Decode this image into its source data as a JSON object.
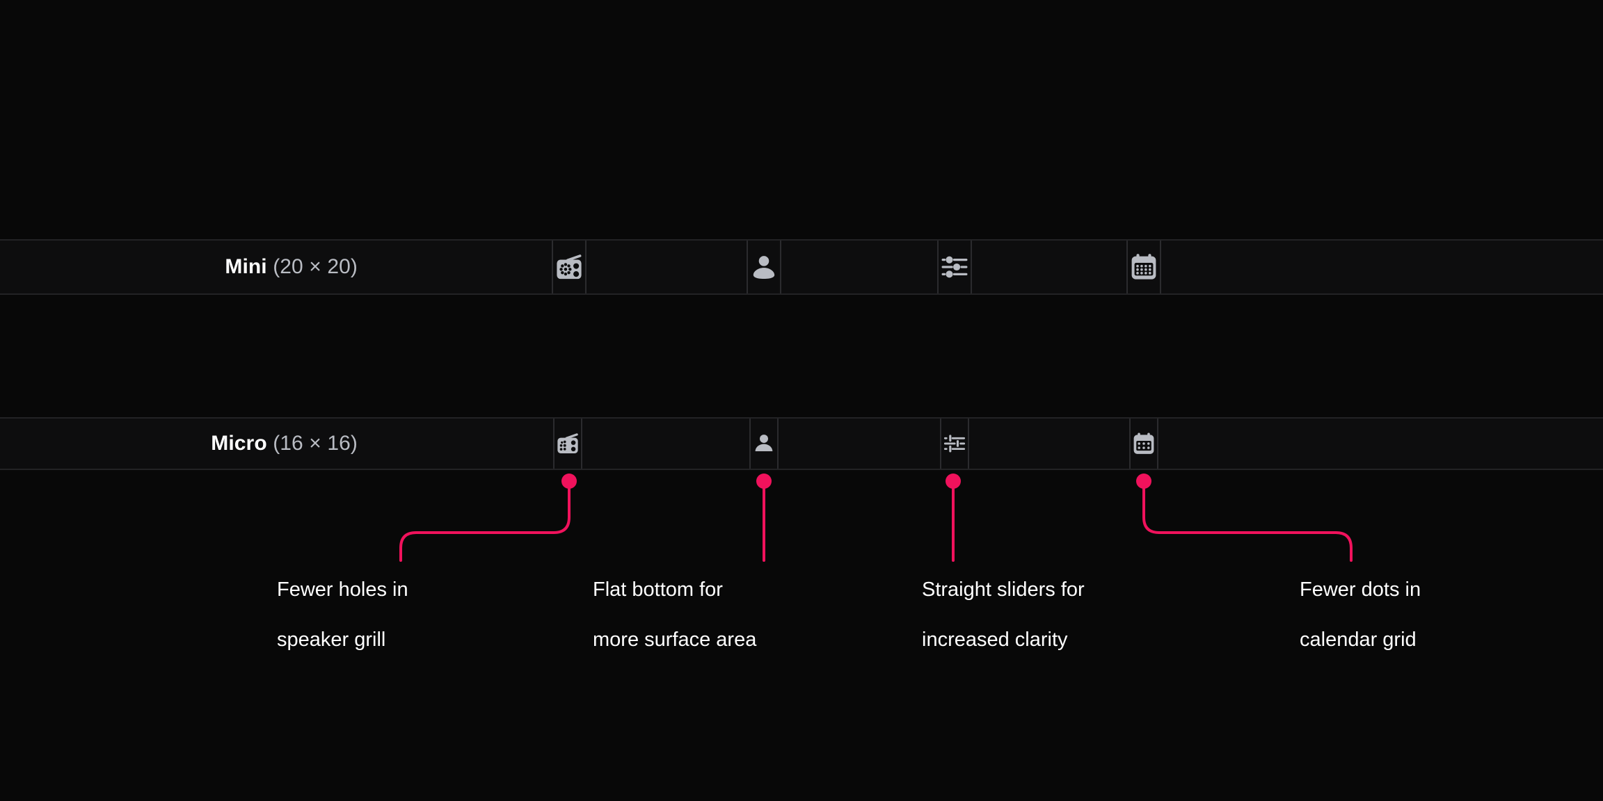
{
  "page": {
    "background_color": "#080808",
    "band_color": "#0d0d0e",
    "icon_color": "#b9bcc3",
    "accent_color": "#f0125c",
    "text_color": "#ffffff"
  },
  "rows": [
    {
      "name": "Mini",
      "dimensions": "(20 × 20)"
    },
    {
      "name": "Micro",
      "dimensions": "(16 × 16)"
    }
  ],
  "icons": [
    {
      "id": "radio-icon",
      "label": "radio"
    },
    {
      "id": "person-icon",
      "label": "person"
    },
    {
      "id": "sliders-icon",
      "label": "sliders"
    },
    {
      "id": "calendar-icon",
      "label": "calendar"
    }
  ],
  "annotations": [
    {
      "text": "Fewer holes in\nspeaker grill"
    },
    {
      "text": "Flat bottom for\nmore surface area"
    },
    {
      "text": "Straight sliders for\nincreased clarity"
    },
    {
      "text": "Fewer dots in\ncalendar grid"
    }
  ]
}
